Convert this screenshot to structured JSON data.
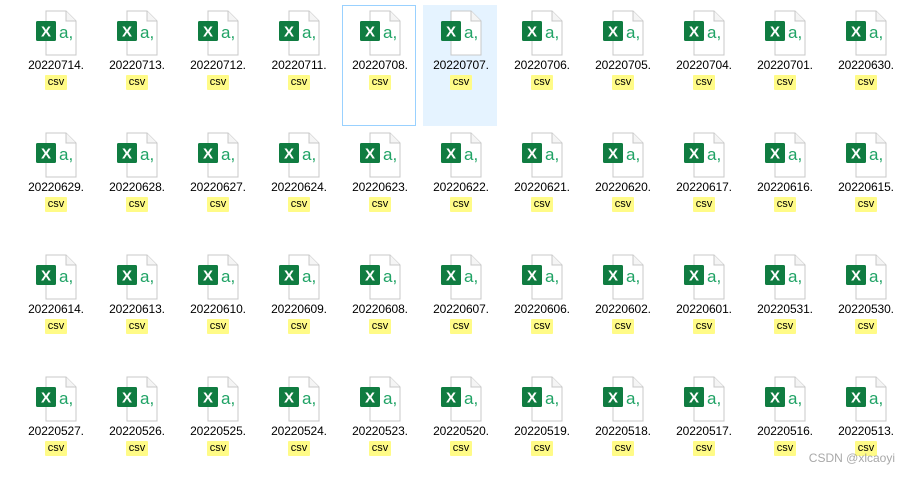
{
  "window": {
    "view": "File Explorer - large icons",
    "file_icon": "excel-csv-icon",
    "colors": {
      "excel_green": "#107c41",
      "excel_light_green": "#21a366",
      "page_gray": "#c8c8c8",
      "ext_highlight": "#fffb87",
      "selection_border": "#99d1ff",
      "hover_background": "#e5f3ff"
    }
  },
  "files": [
    {
      "name": "20220714.",
      "ext": "csv"
    },
    {
      "name": "20220713.",
      "ext": "csv"
    },
    {
      "name": "20220712.",
      "ext": "csv"
    },
    {
      "name": "20220711.",
      "ext": "csv"
    },
    {
      "name": "20220708.",
      "ext": "csv",
      "state": "selected"
    },
    {
      "name": "20220707.",
      "ext": "csv",
      "state": "hover"
    },
    {
      "name": "20220706.",
      "ext": "csv"
    },
    {
      "name": "20220705.",
      "ext": "csv"
    },
    {
      "name": "20220704.",
      "ext": "csv"
    },
    {
      "name": "20220701.",
      "ext": "csv"
    },
    {
      "name": "20220630.",
      "ext": "csv"
    },
    {
      "name": "20220629.",
      "ext": "csv"
    },
    {
      "name": "20220628.",
      "ext": "csv"
    },
    {
      "name": "20220627.",
      "ext": "csv"
    },
    {
      "name": "20220624.",
      "ext": "csv"
    },
    {
      "name": "20220623.",
      "ext": "csv"
    },
    {
      "name": "20220622.",
      "ext": "csv"
    },
    {
      "name": "20220621.",
      "ext": "csv"
    },
    {
      "name": "20220620.",
      "ext": "csv"
    },
    {
      "name": "20220617.",
      "ext": "csv"
    },
    {
      "name": "20220616.",
      "ext": "csv"
    },
    {
      "name": "20220615.",
      "ext": "csv"
    },
    {
      "name": "20220614.",
      "ext": "csv"
    },
    {
      "name": "20220613.",
      "ext": "csv"
    },
    {
      "name": "20220610.",
      "ext": "csv"
    },
    {
      "name": "20220609.",
      "ext": "csv"
    },
    {
      "name": "20220608.",
      "ext": "csv"
    },
    {
      "name": "20220607.",
      "ext": "csv"
    },
    {
      "name": "20220606.",
      "ext": "csv"
    },
    {
      "name": "20220602.",
      "ext": "csv"
    },
    {
      "name": "20220601.",
      "ext": "csv"
    },
    {
      "name": "20220531.",
      "ext": "csv"
    },
    {
      "name": "20220530.",
      "ext": "csv"
    },
    {
      "name": "20220527.",
      "ext": "csv"
    },
    {
      "name": "20220526.",
      "ext": "csv"
    },
    {
      "name": "20220525.",
      "ext": "csv"
    },
    {
      "name": "20220524.",
      "ext": "csv"
    },
    {
      "name": "20220523.",
      "ext": "csv"
    },
    {
      "name": "20220520.",
      "ext": "csv"
    },
    {
      "name": "20220519.",
      "ext": "csv"
    },
    {
      "name": "20220518.",
      "ext": "csv"
    },
    {
      "name": "20220517.",
      "ext": "csv"
    },
    {
      "name": "20220516.",
      "ext": "csv"
    },
    {
      "name": "20220513.",
      "ext": "csv"
    }
  ],
  "watermark": "CSDN @xlcaoyi"
}
